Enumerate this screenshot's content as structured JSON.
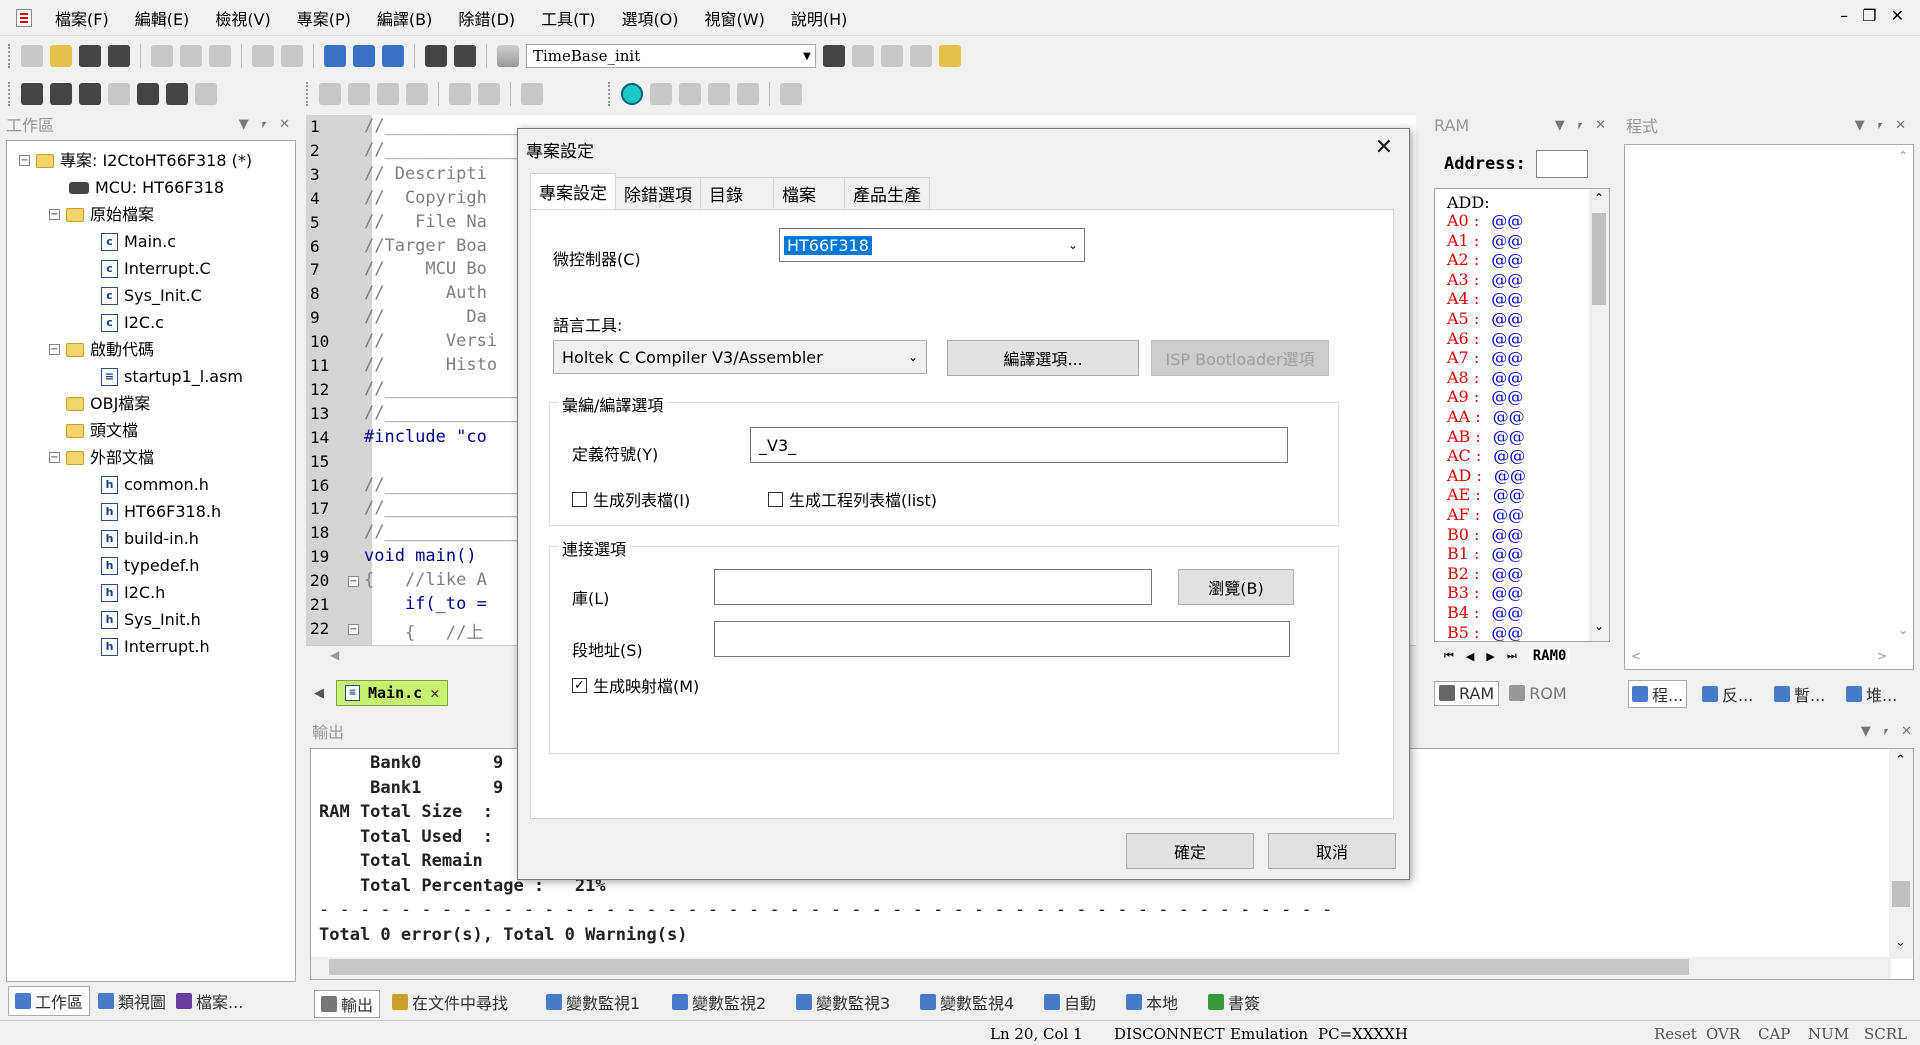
{
  "menu": [
    "檔案(F)",
    "編輯(E)",
    "檢視(V)",
    "專案(P)",
    "編譯(B)",
    "除錯(D)",
    "工具(T)",
    "選項(O)",
    "視窗(W)",
    "說明(H)"
  ],
  "toolbar": {
    "function_combo": "TimeBase_init"
  },
  "workspace": {
    "title": "工作區",
    "project": "專案: I2CtoHT66F318 (*)",
    "mcu": "MCU: HT66F318",
    "source_folder": "原始檔案",
    "source_files": [
      "Main.c",
      "Interrupt.C",
      "Sys_Init.C",
      "I2C.c"
    ],
    "startup_folder": "啟動代碼",
    "startup_files": [
      "startup1_l.asm"
    ],
    "obj_folder": "OBJ檔案",
    "header_folder": "頭文檔",
    "external_folder": "外部文檔",
    "external_files": [
      "common.h",
      "HT66F318.h",
      "build-in.h",
      "typedef.h",
      "I2C.h",
      "Sys_Init.h",
      "Interrupt.h"
    ],
    "bottom_tabs": [
      "工作區",
      "類視圖",
      "檔案..."
    ]
  },
  "editor": {
    "line_numbers": [
      "1",
      "2",
      "3",
      "4",
      "5",
      "6",
      "7",
      "8",
      "9",
      "10",
      "11",
      "12",
      "13",
      "14",
      "15",
      "16",
      "17",
      "18",
      "19",
      "20",
      "21",
      "22"
    ],
    "lines": [
      "//______________",
      "//______________",
      "// Descripti",
      "//  Copyrigh",
      "//   File Na",
      "//Targer Boa",
      "//    MCU Bo",
      "//      Auth",
      "//        Da",
      "//      Versi",
      "//      Histo",
      "//______________",
      "//______________",
      "#include \"co",
      "",
      "//______________",
      "//______________",
      "//______________",
      "void main()",
      "{   //like A",
      "    if(_to =",
      "    {   //上"
    ],
    "tab": "Main.c"
  },
  "dialog": {
    "title": "專案設定",
    "tabs": [
      "專案設定",
      "除錯選項",
      "目錄",
      "檔案",
      "產品生產"
    ],
    "mcu_label": "微控制器(C)",
    "mcu_value": "HT66F318",
    "lang_label": "語言工具:",
    "lang_value": "Holtek C Compiler V3/Assembler",
    "compile_options_btn": "編譯選項...",
    "isp_btn": "ISP Bootloader選項",
    "asm_group": "彙編/編譯選項",
    "define_label": "定義符號(Y)",
    "define_value": "_V3_",
    "gen_list_label": "生成列表檔(I)",
    "gen_project_list_label": "生成工程列表檔(list)",
    "link_group": "連接選項",
    "lib_label": "庫(L)",
    "browse_btn": "瀏覽(B)",
    "section_label": "段地址(S)",
    "gen_map_label": "生成映射檔(M)",
    "ok_btn": "確定",
    "cancel_btn": "取消"
  },
  "ram": {
    "title": "RAM",
    "address_label": "Address:",
    "header": "ADD:",
    "rows": [
      "A0",
      "A1",
      "A2",
      "A3",
      "A4",
      "A5",
      "A6",
      "A7",
      "A8",
      "A9",
      "AA",
      "AB",
      "AC",
      "AD",
      "AE",
      "AF",
      "B0",
      "B1",
      "B2",
      "B3",
      "B4",
      "B5"
    ],
    "value": "@@",
    "bank_tab": "RAM0",
    "tabs": [
      "RAM",
      "ROM"
    ]
  },
  "program": {
    "title": "程式",
    "tabs": [
      "程...",
      "反...",
      "暫...",
      "堆..."
    ]
  },
  "output": {
    "title": "輸出",
    "lines": [
      "     Bank0       9",
      "     Bank1       9",
      "RAM Total Size  :",
      "    Total Used  :",
      "    Total Remain",
      "    Total Percentage :   21%",
      "- - - - - - - - - - - - - - - - - - - - - - - - - - - - - - - - - - - - - - - - - - - - - - - - - -",
      "Total 0 error(s), Total 0 Warning(s)"
    ],
    "tabs": [
      "輸出",
      "在文件中尋找",
      "變數監視1",
      "變數監視2",
      "變數監視3",
      "變數監視4",
      "自動",
      "本地",
      "書簽"
    ]
  },
  "status": {
    "position": "Ln 20, Col 1",
    "connection": "DISCONNECT",
    "mode": "Emulation",
    "pc": "PC=XXXXH",
    "indicators": [
      "Reset",
      "OVR",
      "CAP",
      "NUM",
      "SCRL"
    ]
  }
}
